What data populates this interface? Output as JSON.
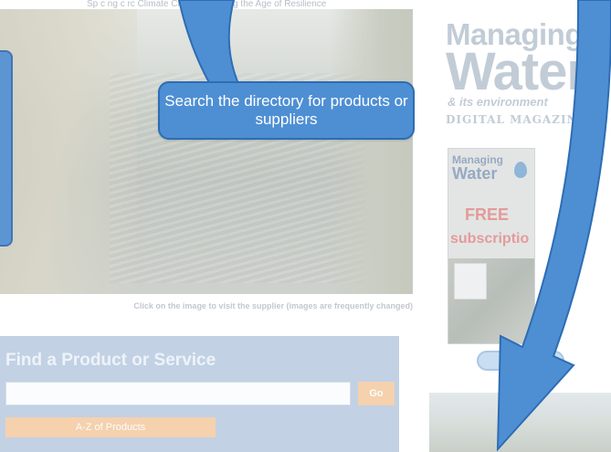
{
  "top_nav": {
    "text": "Sp c ng  c            rc     Climate Change  Building the Age of Resilience"
  },
  "featured_image": {
    "caption": "Click on the image to visit the supplier (images are frequently changed)"
  },
  "find_panel": {
    "title": "Find a Product or Service",
    "search_value": "",
    "go_label": "Go",
    "az_label": "A-Z of Products"
  },
  "magazine": {
    "line1": "Managing",
    "line2": "Water",
    "line3": "& its environment",
    "line4": "DIGITAL MAGAZINE",
    "cover_title1": "Managing",
    "cover_title2": "Water",
    "cover_free": "FREE",
    "cover_subscription": "subscriptio"
  },
  "tutorial": {
    "callout_text": "Search the directory for products or suppliers"
  },
  "colors": {
    "callout_blue": "#4e8fd4",
    "arrow_blue": "#4e8fd4",
    "panel_blue": "#c2d1e4",
    "button_orange": "#f5d1ae"
  }
}
